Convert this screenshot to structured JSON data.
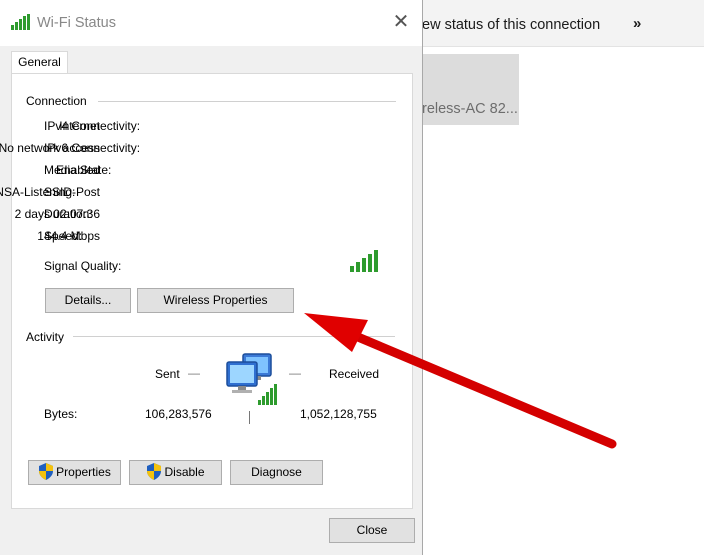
{
  "background": {
    "toolbar_text": "ew status of this connection",
    "chevron": "»",
    "adapter_name": "reless-AC 82..."
  },
  "window": {
    "title": "Wi-Fi Status",
    "close_glyph": "✕"
  },
  "tab": {
    "label": "General"
  },
  "connection": {
    "heading": "Connection",
    "rows": [
      {
        "label": "IPv4 Connectivity:",
        "value": "Internet"
      },
      {
        "label": "IPv6 Connectivity:",
        "value": "No network access"
      },
      {
        "label": "Media State:",
        "value": "Enabled"
      },
      {
        "label": "SSID:",
        "value": "NSA-Listening-Post"
      },
      {
        "label": "Duration:",
        "value": "2 days 02:07:36"
      },
      {
        "label": "Speed:",
        "value": "144.4 Mbps"
      }
    ],
    "signal_label": "Signal Quality:",
    "signal_bars": 5,
    "signal_max": 5,
    "details_button": "Details...",
    "wireless_properties_button": "Wireless Properties"
  },
  "activity": {
    "heading": "Activity",
    "sent_label": "Sent",
    "received_label": "Received",
    "bytes_label": "Bytes:",
    "sent_bytes": "106,283,576",
    "received_bytes": "1,052,128,755",
    "dash": "—"
  },
  "actions": {
    "properties": "Properties",
    "disable": "Disable",
    "diagnose": "Diagnose",
    "close": "Close"
  },
  "colors": {
    "annotation_arrow": "#e00000",
    "signal_green": "#2e9b2e"
  },
  "icons": [
    "wifi-signal-icon",
    "close-icon",
    "network-computers-icon",
    "shield-icon",
    "red-arrow-annotation"
  ]
}
